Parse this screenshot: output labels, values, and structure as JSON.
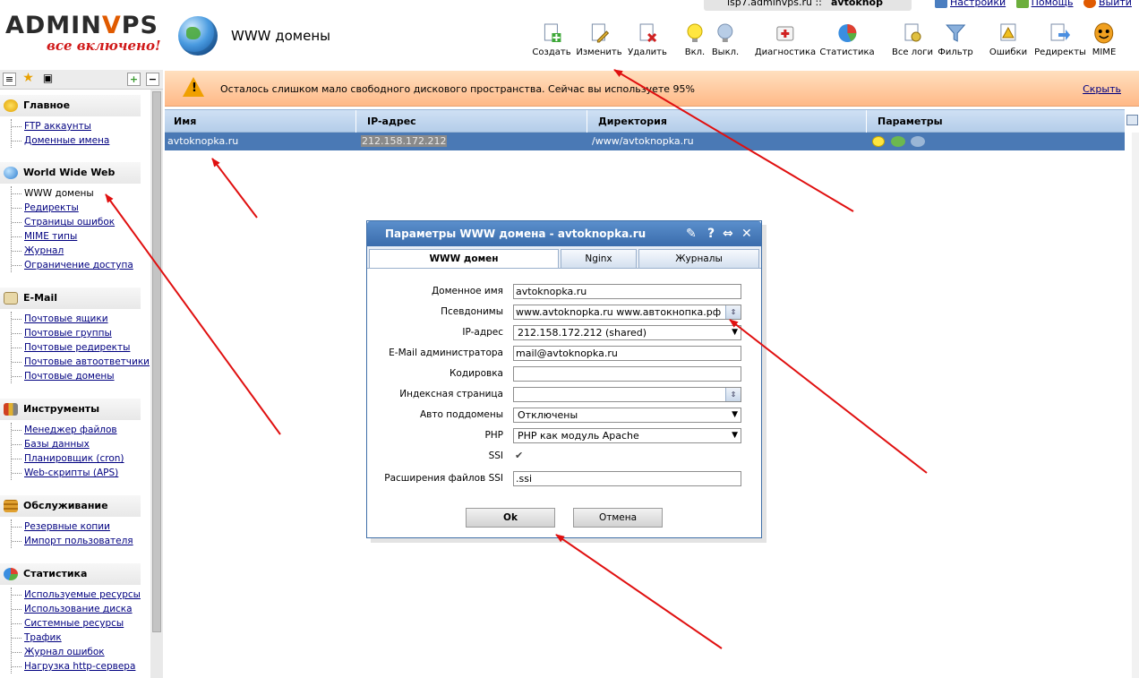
{
  "logo": {
    "brand_a": "ADMIN",
    "brand_b": "V",
    "brand_c": "PS",
    "tagline": "все включено!"
  },
  "page_title": "WWW домены",
  "topbar": {
    "session": "isp7.adminvps.ru ::",
    "user": "avtoknop",
    "settings": "Настройки",
    "help": "Помощь",
    "logout": "Выйти"
  },
  "toolbar": [
    {
      "label": "Создать",
      "icon": "create-icon"
    },
    {
      "label": "Изменить",
      "icon": "edit-icon"
    },
    {
      "label": "Удалить",
      "icon": "delete-icon"
    },
    {
      "label": "Вкл.",
      "icon": "enable-icon"
    },
    {
      "label": "Выкл.",
      "icon": "disable-icon"
    },
    {
      "label": "Диагностика",
      "icon": "diagnostics-icon"
    },
    {
      "label": "Статистика",
      "icon": "statistics-icon"
    },
    {
      "label": "Все логи",
      "icon": "all-logs-icon"
    },
    {
      "label": "Фильтр",
      "icon": "filter-icon"
    },
    {
      "label": "Ошибки",
      "icon": "errors-icon"
    },
    {
      "label": "Редиректы",
      "icon": "redirects-icon"
    },
    {
      "label": "MIME",
      "icon": "mime-icon"
    }
  ],
  "sidebar": {
    "groups": [
      {
        "title": "Главное",
        "items": [
          "FTP аккаунты",
          "Доменные имена"
        ]
      },
      {
        "title": "World Wide Web",
        "items": [
          "WWW домены",
          "Редиректы",
          "Страницы ошибок",
          "MIME типы",
          "Журнал",
          "Ограничение доступа"
        ]
      },
      {
        "title": "E-Mail",
        "items": [
          "Почтовые ящики",
          "Почтовые группы",
          "Почтовые редиректы",
          "Почтовые автоответчики",
          "Почтовые домены"
        ]
      },
      {
        "title": "Инструменты",
        "items": [
          "Менеджер файлов",
          "Базы данных",
          "Планировщик (cron)",
          "Web-скрипты (APS)"
        ]
      },
      {
        "title": "Обслуживание",
        "items": [
          "Резервные копии",
          "Импорт пользователя"
        ]
      },
      {
        "title": "Статистика",
        "items": [
          "Используемые ресурсы",
          "Использование диска",
          "Системные ресурсы",
          "Трафик",
          "Журнал ошибок",
          "Нагрузка http-сервера"
        ]
      }
    ]
  },
  "warning": {
    "message": "Осталось слишком мало свободного дискового пространства. Сейчас вы используете 95%",
    "hide": "Скрыть"
  },
  "table": {
    "columns": [
      "Имя",
      "IP-адрес",
      "Директория",
      "Параметры"
    ],
    "rows": [
      {
        "name": "avtoknopka.ru",
        "ip": "212.158.172.212",
        "dir": "/www/avtoknopka.ru"
      }
    ]
  },
  "dialog": {
    "title": "Параметры WWW домена - avtoknopka.ru",
    "tabs": [
      "WWW домен",
      "Nginx",
      "Журналы"
    ],
    "fields": {
      "domain_label": "Доменное имя",
      "domain_value": "avtoknopka.ru",
      "aliases_label": "Псевдонимы",
      "aliases_value": "www.avtoknopka.ru www.автокнопка.рф",
      "ip_label": "IP-адрес",
      "ip_value": "212.158.172.212 (shared)",
      "email_label": "E-Mail администратора",
      "email_value": "mail@avtoknopka.ru",
      "encoding_label": "Кодировка",
      "encoding_value": "",
      "index_label": "Индексная страница",
      "index_value": "",
      "autosub_label": "Авто поддомены",
      "autosub_value": "Отключены",
      "php_label": "PHP",
      "php_value": "PHP как модуль Apache",
      "ssi_label": "SSI",
      "ssi_checked": true,
      "ssiext_label": "Расширения файлов SSI",
      "ssiext_value": ".ssi"
    },
    "ok": "Ok",
    "cancel": "Отмена"
  }
}
